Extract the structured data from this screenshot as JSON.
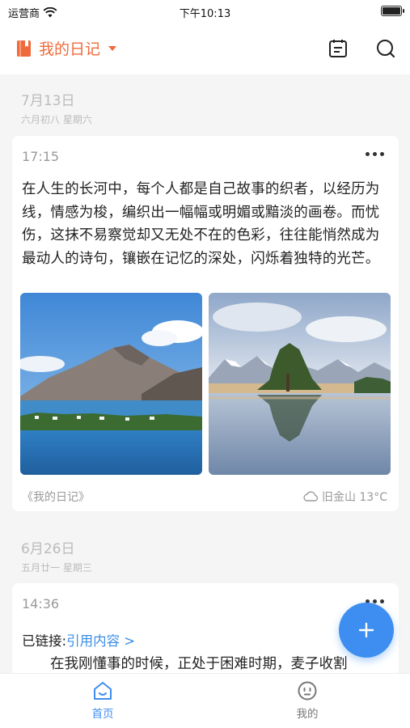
{
  "status_bar": {
    "carrier": "运营商",
    "time": "下午10:13",
    "battery_level": 0.9
  },
  "header": {
    "title": "我的日记",
    "icons": [
      "book-icon",
      "calendar-icon",
      "search-icon"
    ]
  },
  "entries": [
    {
      "date": "7月13日",
      "lunar_weekday": "六月初八  星期六",
      "time": "17:15",
      "text": "在人生的长河中，每个人都是自己故事的织者，以经历为线，情感为梭，编织出一幅幅或明媚或黯淡的画卷。而忧伤，这抹不易察觉却又无处不在的色彩，往往能悄然成为最动人的诗句，镶嵌在记忆的深处，闪烁着独特的光芒。",
      "photos": [
        "mountain-lake-photo",
        "reflection-lake-photo"
      ],
      "diary_name": "《我的日记》",
      "weather": "旧金山 13°C"
    },
    {
      "date": "6月26日",
      "lunar_weekday": "五月廿一  星期三",
      "time": "14:36",
      "link_label": "已链接:",
      "link_text": "引用内容 >",
      "text": "在我刚懂事的时候，正处于困难时期，麦子收割"
    }
  ],
  "tabs": [
    {
      "label": "首页",
      "icon": "home-icon",
      "active": true
    },
    {
      "label": "我的",
      "icon": "profile-icon",
      "active": false
    }
  ],
  "colors": {
    "accent": "#ee6b3b",
    "primary_blue": "#3d8ef0",
    "background": "#f5f5f5"
  }
}
